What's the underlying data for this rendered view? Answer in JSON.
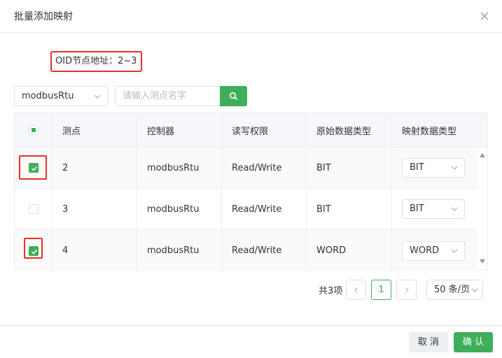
{
  "dialog": {
    "title": "批量添加映射"
  },
  "oid": {
    "text": "OID节点地址：2~3"
  },
  "filter": {
    "protocol": "modbusRtu",
    "search_placeholder": "请输入测点名字"
  },
  "table": {
    "headers": [
      "测点",
      "控制器",
      "读写权限",
      "原始数据类型",
      "映射数据类型"
    ],
    "rows": [
      {
        "point": "2",
        "controller": "modbusRtu",
        "access": "Read/Write",
        "raw_type": "BIT",
        "map_type": "BIT",
        "checked": true
      },
      {
        "point": "3",
        "controller": "modbusRtu",
        "access": "Read/Write",
        "raw_type": "BIT",
        "map_type": "BIT",
        "checked": false
      },
      {
        "point": "4",
        "controller": "modbusRtu",
        "access": "Read/Write",
        "raw_type": "WORD",
        "map_type": "WORD",
        "checked": true
      }
    ]
  },
  "pagination": {
    "total": "共3项",
    "current": "1",
    "page_size": "50 条/页"
  },
  "footer": {
    "cancel": "取 消",
    "confirm": "确 认"
  },
  "colors": {
    "accent": "#3fae5a",
    "highlight": "#e8302a"
  }
}
